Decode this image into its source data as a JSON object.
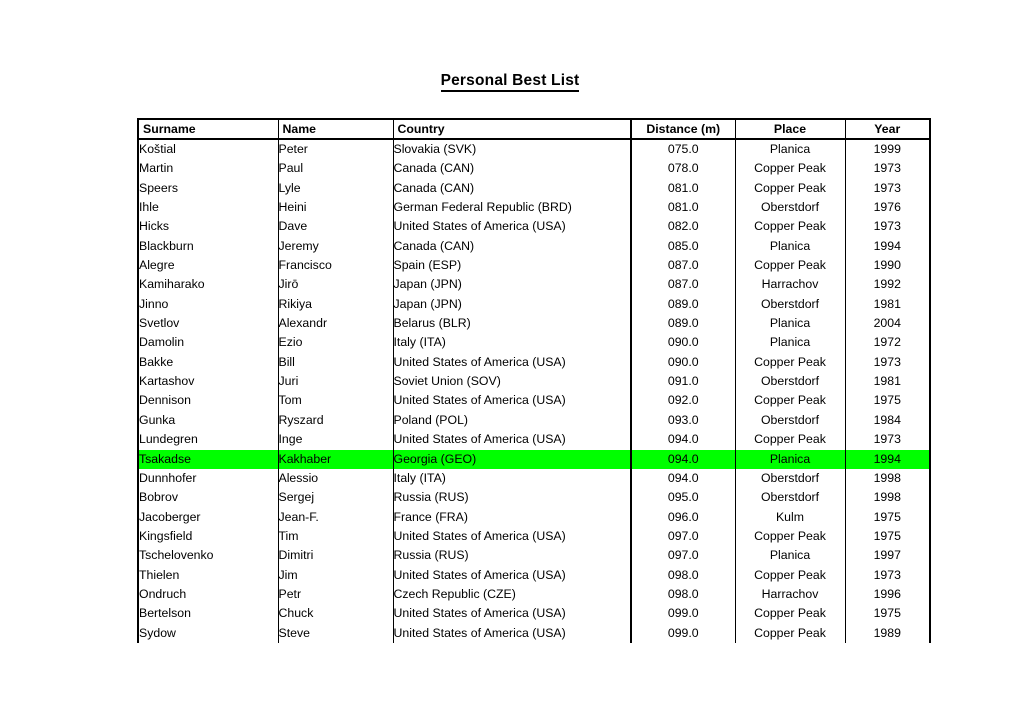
{
  "page": {
    "title": "Personal Best List"
  },
  "table": {
    "columns": [
      {
        "key": "surname",
        "label": "Surname",
        "align": "left"
      },
      {
        "key": "name",
        "label": "Name",
        "align": "left"
      },
      {
        "key": "country",
        "label": "Country",
        "align": "left"
      },
      {
        "key": "distance",
        "label": "Distance (m)",
        "align": "center"
      },
      {
        "key": "place",
        "label": "Place",
        "align": "center"
      },
      {
        "key": "year",
        "label": "Year",
        "align": "center"
      }
    ],
    "highlight_color": "#00FF00",
    "highlighted_row_index": 19,
    "rows": [
      {
        "surname": "Koštial",
        "name": "Peter",
        "country": "Slovakia (SVK)",
        "distance": "075.0",
        "place": "Planica",
        "year": "1999",
        "highlighted": false
      },
      {
        "surname": "Martin",
        "name": "Paul",
        "country": "Canada (CAN)",
        "distance": "078.0",
        "place": "Copper Peak",
        "year": "1973",
        "highlighted": false
      },
      {
        "surname": "Speers",
        "name": "Lyle",
        "country": "Canada (CAN)",
        "distance": "081.0",
        "place": "Copper Peak",
        "year": "1973",
        "highlighted": false
      },
      {
        "surname": "Ihle",
        "name": "Heini",
        "country": "German Federal Republic (BRD)",
        "distance": "081.0",
        "place": "Oberstdorf",
        "year": "1976",
        "highlighted": false
      },
      {
        "surname": "Hicks",
        "name": "Dave",
        "country": "United States of America (USA)",
        "distance": "082.0",
        "place": "Copper Peak",
        "year": "1973",
        "highlighted": false
      },
      {
        "surname": "Blackburn",
        "name": "Jeremy",
        "country": "Canada (CAN)",
        "distance": "085.0",
        "place": "Planica",
        "year": "1994",
        "highlighted": false
      },
      {
        "surname": "Alegre",
        "name": "Francisco",
        "country": "Spain (ESP)",
        "distance": "087.0",
        "place": "Copper Peak",
        "year": "1990",
        "highlighted": false
      },
      {
        "surname": "Kamiharako",
        "name": "Jirō",
        "country": "Japan (JPN)",
        "distance": "087.0",
        "place": "Harrachov",
        "year": "1992",
        "highlighted": false
      },
      {
        "surname": "Jinno",
        "name": "Rikiya",
        "country": "Japan (JPN)",
        "distance": "089.0",
        "place": "Oberstdorf",
        "year": "1981",
        "highlighted": false
      },
      {
        "surname": "Svetlov",
        "name": "Alexandr",
        "country": "Belarus (BLR)",
        "distance": "089.0",
        "place": "Planica",
        "year": "2004",
        "highlighted": false
      },
      {
        "surname": "Damolin",
        "name": "Ezio",
        "country": "Italy (ITA)",
        "distance": "090.0",
        "place": "Planica",
        "year": "1972",
        "highlighted": false
      },
      {
        "surname": "Bakke",
        "name": "Bill",
        "country": "United States of America (USA)",
        "distance": "090.0",
        "place": "Copper Peak",
        "year": "1973",
        "highlighted": false
      },
      {
        "surname": "Kartashov",
        "name": "Juri",
        "country": "Soviet Union (SOV)",
        "distance": "091.0",
        "place": "Oberstdorf",
        "year": "1981",
        "highlighted": false
      },
      {
        "surname": "Dennison",
        "name": "Tom",
        "country": "United States of America (USA)",
        "distance": "092.0",
        "place": "Copper Peak",
        "year": "1975",
        "highlighted": false
      },
      {
        "surname": "Gunka",
        "name": "Ryszard",
        "country": "Poland (POL)",
        "distance": "093.0",
        "place": "Oberstdorf",
        "year": "1984",
        "highlighted": false
      },
      {
        "surname": "Lundegren",
        "name": "Inge",
        "country": "United States of America (USA)",
        "distance": "094.0",
        "place": "Copper Peak",
        "year": "1973",
        "highlighted": false
      },
      {
        "surname": "Tsakadse",
        "name": "Kakhaber",
        "country": "Georgia (GEO)",
        "distance": "094.0",
        "place": "Planica",
        "year": "1994",
        "highlighted": true
      },
      {
        "surname": "Dunnhofer",
        "name": "Alessio",
        "country": "Italy (ITA)",
        "distance": "094.0",
        "place": "Oberstdorf",
        "year": "1998",
        "highlighted": false
      },
      {
        "surname": "Bobrov",
        "name": "Sergej",
        "country": "Russia (RUS)",
        "distance": "095.0",
        "place": "Oberstdorf",
        "year": "1998",
        "highlighted": false
      },
      {
        "surname": "Jacoberger",
        "name": "Jean-F.",
        "country": "France (FRA)",
        "distance": "096.0",
        "place": "Kulm",
        "year": "1975",
        "highlighted": false
      },
      {
        "surname": "Kingsfield",
        "name": "Tim",
        "country": "United States of America (USA)",
        "distance": "097.0",
        "place": "Copper Peak",
        "year": "1975",
        "highlighted": false
      },
      {
        "surname": "Tschelovenko",
        "name": "Dimitri",
        "country": "Russia (RUS)",
        "distance": "097.0",
        "place": "Planica",
        "year": "1997",
        "highlighted": false
      },
      {
        "surname": "Thielen",
        "name": "Jim",
        "country": "United States of America (USA)",
        "distance": "098.0",
        "place": "Copper Peak",
        "year": "1973",
        "highlighted": false
      },
      {
        "surname": "Ondruch",
        "name": "Petr",
        "country": "Czech Republic (CZE)",
        "distance": "098.0",
        "place": "Harrachov",
        "year": "1996",
        "highlighted": false
      },
      {
        "surname": "Bertelson",
        "name": "Chuck",
        "country": "United States of America (USA)",
        "distance": "099.0",
        "place": "Copper Peak",
        "year": "1975",
        "highlighted": false
      },
      {
        "surname": "Sydow",
        "name": "Steve",
        "country": "United States of America (USA)",
        "distance": "099.0",
        "place": "Copper Peak",
        "year": "1989",
        "highlighted": false
      }
    ]
  }
}
